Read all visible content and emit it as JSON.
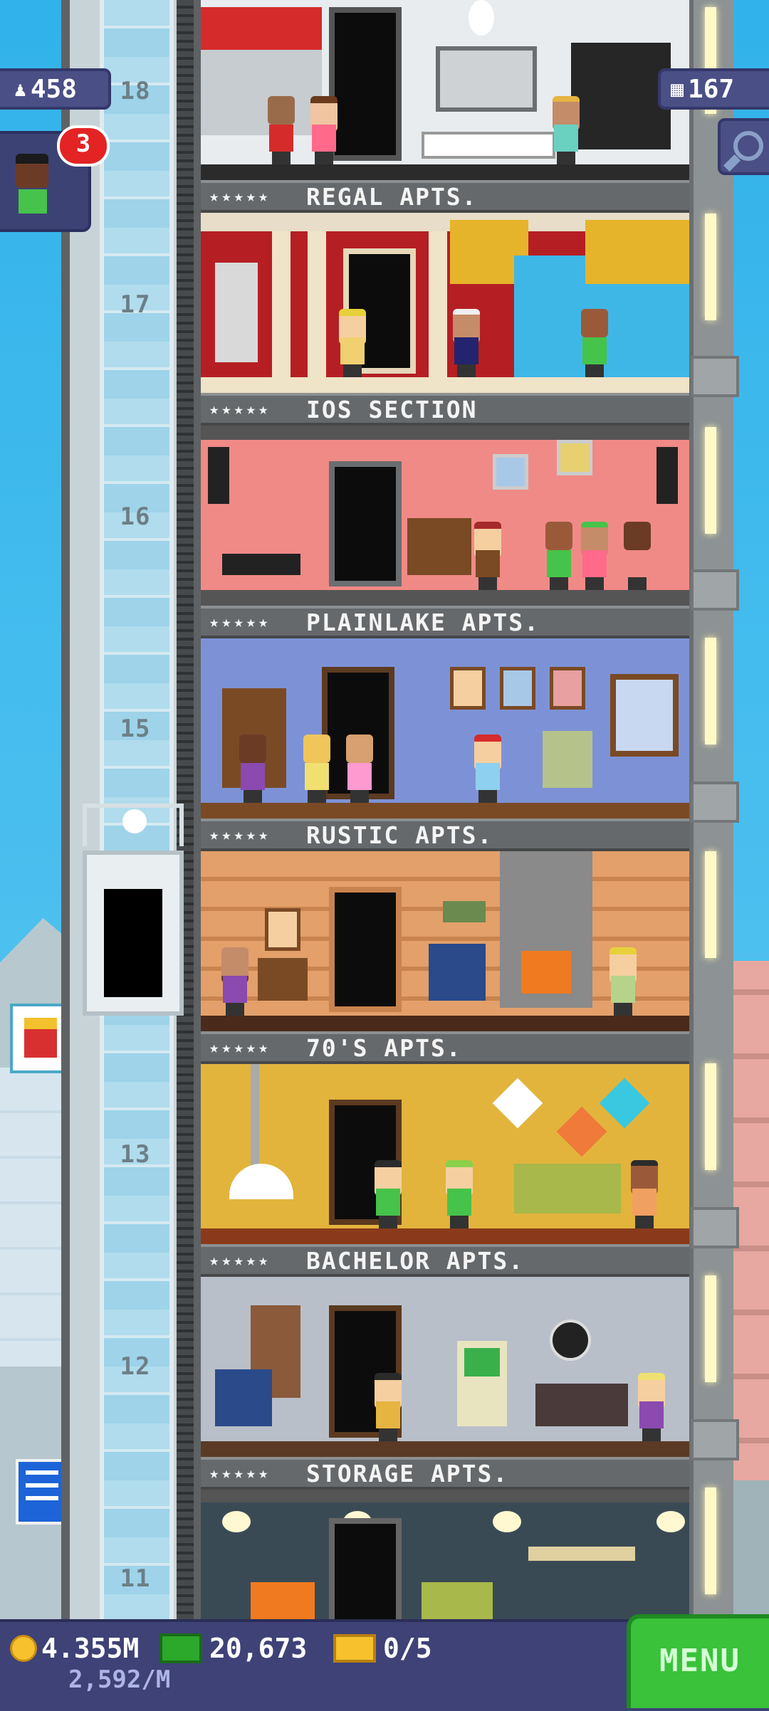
{
  "hud": {
    "population": "458",
    "visitor_badge": "3",
    "floors_count": "167",
    "coins": "4.355M",
    "bux": "20,673",
    "tickets": "0/5",
    "rate": "2,592/M",
    "menu_label": "MENU"
  },
  "floor_numbers": [
    "18",
    "17",
    "16",
    "15",
    "13",
    "12",
    "11"
  ],
  "floors": [
    {
      "name": "REGAL APTS.",
      "stars": "★★★★★",
      "room_color": "#e8ecee"
    },
    {
      "name": "IOS SECTION",
      "stars": "★★★★★",
      "room_color": "#b51f24"
    },
    {
      "name": "PLAINLAKE APTS.",
      "stars": "★★★★★",
      "room_color": "#f08a86"
    },
    {
      "name": "RUSTIC APTS.",
      "stars": "★★★★★",
      "room_color": "#7d92d6"
    },
    {
      "name": "70'S APTS.",
      "stars": "★★★★★",
      "room_color": "#e3a06a"
    },
    {
      "name": "BACHELOR APTS.",
      "stars": "★★★★★",
      "room_color": "#e2b43c"
    },
    {
      "name": "STORAGE APTS.",
      "stars": "★★★★★",
      "room_color": "#b9bfc9"
    }
  ],
  "icons": {
    "population": "person-icon",
    "floors": "building-icon",
    "search": "search-icon",
    "coins": "coin-icon",
    "bux": "bux-icon",
    "tickets": "ticket-icon"
  },
  "colors": {
    "hud_bg": "#4a4f86",
    "menu_green": "#39c23a",
    "badge_red": "#e32324"
  }
}
